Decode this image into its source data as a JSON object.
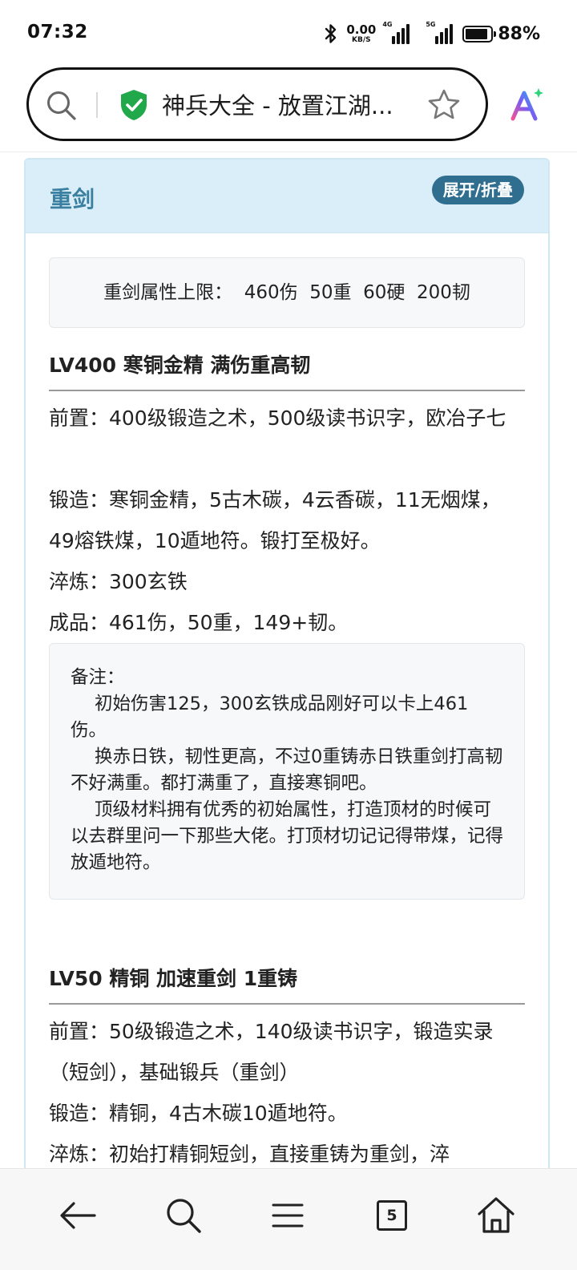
{
  "status_bar": {
    "time": "07:32",
    "net_speed_value": "0.00",
    "net_speed_unit": "KB/S",
    "signal1_label": "4G",
    "signal2_label": "5G",
    "battery_percent": "88%",
    "battery_level": 0.88
  },
  "address_bar": {
    "page_title": "神兵大全 - 放置江湖...",
    "icons": [
      "search-icon",
      "shield-check-icon",
      "star-icon",
      "ai-assistant-icon"
    ]
  },
  "panel": {
    "title": "重剑",
    "toggle_label": "展开/折叠",
    "attr_limit": "重剑属性上限：  460伤  50重  60硬  200韧",
    "section1": {
      "title": "LV400 寒铜金精 满伤重高韧",
      "pre": "前置：400级锻造之术，500级读书识字，欧冶子七",
      "forge": "锻造：寒铜金精，5古木碳，4云香碳，11无烟煤，49熔铁煤，10遁地符。锻打至极好。",
      "refine": "淬炼：300玄铁",
      "result": "成品：461伤，50重，149+韧。",
      "note": {
        "label": "备注：",
        "p1": "初始伤害125，300玄铁成品刚好可以卡上461伤。",
        "p2": "换赤日铁，韧性更高，不过0重铸赤日铁重剑打高韧不好满重。都打满重了，直接寒铜吧。",
        "p3": "顶级材料拥有优秀的初始属性，打造顶材的时候可以去群里问一下那些大佬。打顶材切记记得带煤，记得放遁地符。"
      }
    },
    "section2": {
      "title": "LV50 精铜 加速重剑 1重铸",
      "pre": "前置：50级锻造之术，140级读书识字，锻造实录（短剑），基础锻兵（重剑）",
      "forge": "锻造：精铜，4古木碳10遁地符。",
      "refine": "淬炼：初始打精铜短剑，直接重铸为重剑，淬"
    }
  },
  "bottom_nav": {
    "tab_count": "5",
    "icons": [
      "back-arrow-icon",
      "search-icon",
      "menu-icon",
      "tabs-icon",
      "home-icon"
    ]
  }
}
